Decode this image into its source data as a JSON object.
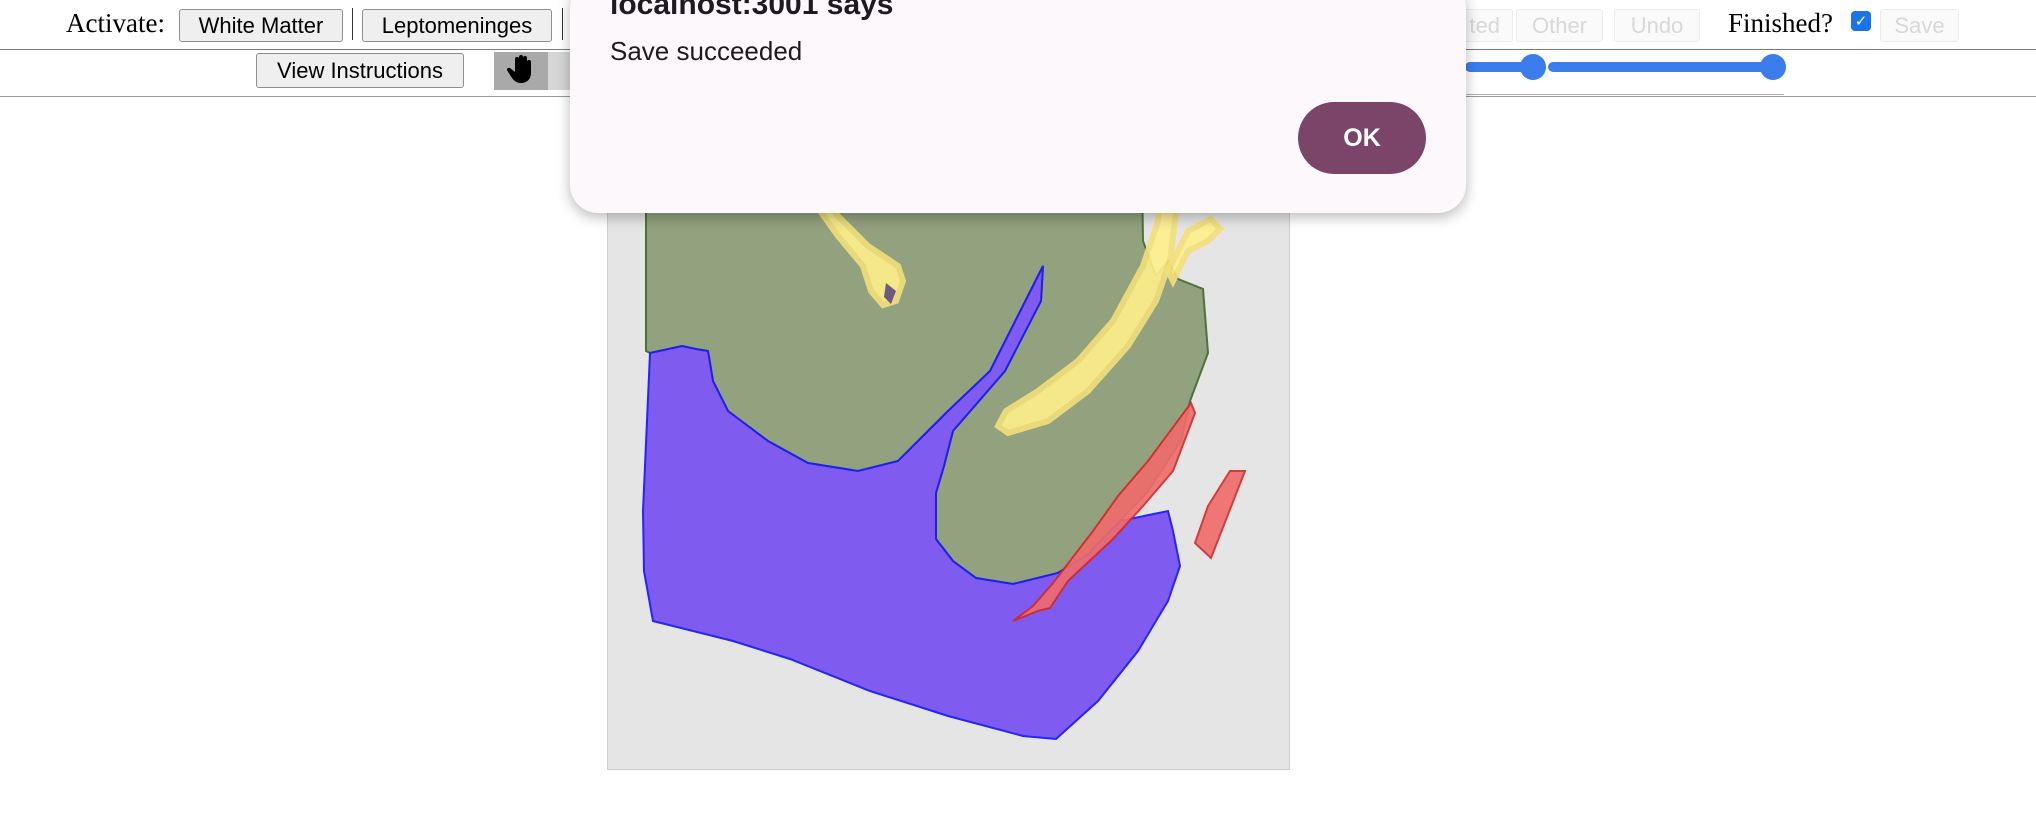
{
  "toolbar": {
    "activate_label": "Activate:",
    "white_matter_button": "White Matter",
    "leptomeninges_button": "Leptomeninges",
    "partial_button": "ted",
    "other_button": "Other",
    "undo_button": "Undo",
    "finished_label": "Finished?",
    "finished_checked": true,
    "save_button": "Save",
    "view_instructions_button": "View Instructions",
    "hand_tool_icon": "hand-icon"
  },
  "dialog": {
    "title": "localhost:3001 says",
    "message": "Save succeeded",
    "ok_button": "OK",
    "ok_color": "#7b4569"
  },
  "annotations": {
    "colors": {
      "gray_matter": "#8c9c76",
      "white_matter": "#7a55f0",
      "yellow": "#fff08a",
      "red": "#f26b6b"
    }
  }
}
